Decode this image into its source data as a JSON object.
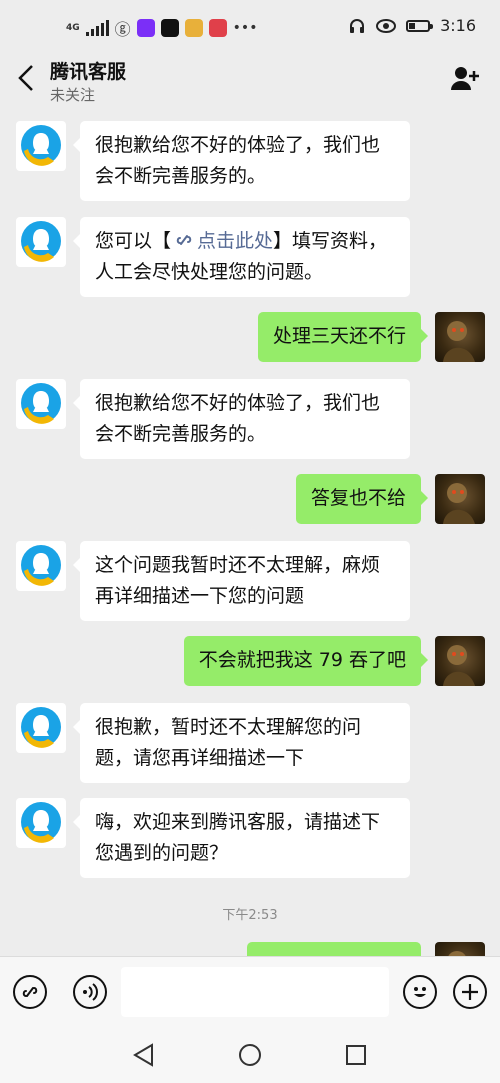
{
  "status_bar": {
    "network_label": "4G",
    "time": "3:16"
  },
  "header": {
    "title": "腾讯客服",
    "subtitle": "未关注"
  },
  "messages": [
    {
      "from": "service",
      "text": "很抱歉给您不好的体验了，我们也会不断完善服务的。"
    },
    {
      "from": "service",
      "parts": [
        "您可以【",
        "点击此处",
        "】填写资料，人工会尽快处理您的问题。"
      ]
    },
    {
      "from": "user",
      "text": "处理三天还不行"
    },
    {
      "from": "service",
      "text": "很抱歉给您不好的体验了，我们也会不断完善服务的。"
    },
    {
      "from": "user",
      "text": "答复也不给"
    },
    {
      "from": "service",
      "text": "这个问题我暂时还不太理解，麻烦再详细描述一下您的问题"
    },
    {
      "from": "user",
      "text": "不会就把我这 79 吞了吧"
    },
    {
      "from": "service",
      "text": "很抱歉，暂时还不太理解您的问题，请您再详细描述一下"
    },
    {
      "from": "service",
      "text": "嗨，欢迎来到腾讯客服，请描述下您遇到的问题？"
    }
  ],
  "timestamp": "下午2:53",
  "input": {
    "placeholder": "",
    "value": ""
  },
  "colors": {
    "background": "#ededed",
    "user_bubble": "#95ec69",
    "service_bubble": "#ffffff",
    "link": "#576b95",
    "qq_blue": "#1aa3e6",
    "qq_yellow": "#f2b705"
  }
}
